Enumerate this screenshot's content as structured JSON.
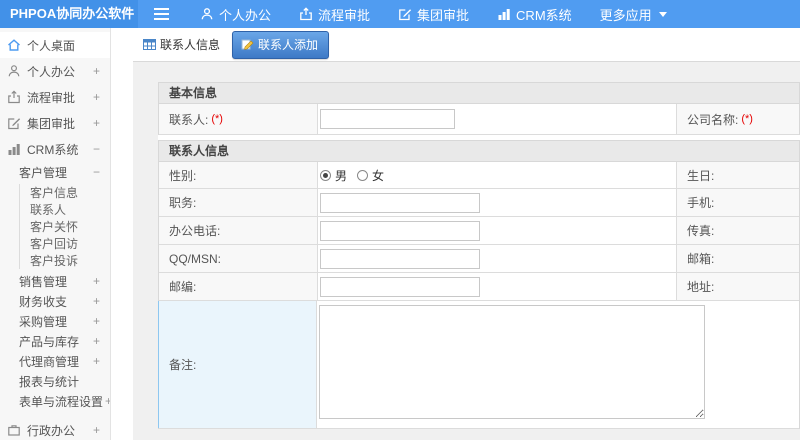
{
  "topbar": {
    "logo": "PHPOA协同办公软件",
    "menu": [
      {
        "label": "个人办公",
        "icon": "user-icon"
      },
      {
        "label": "流程审批",
        "icon": "workflow-icon"
      },
      {
        "label": "集团审批",
        "icon": "edit-icon"
      },
      {
        "label": "CRM系统",
        "icon": "chart-icon"
      },
      {
        "label": "更多应用",
        "icon": "caret-down-icon"
      }
    ]
  },
  "sidebar": {
    "items": [
      {
        "label": "个人桌面",
        "icon": "home-icon",
        "expand": "",
        "active": true
      },
      {
        "label": "个人办公",
        "icon": "user-icon",
        "expand": "+"
      },
      {
        "label": "流程审批",
        "icon": "workflow-icon",
        "expand": "+"
      },
      {
        "label": "集团审批",
        "icon": "edit-icon",
        "expand": "+"
      },
      {
        "label": "CRM系统",
        "icon": "chart-icon",
        "expand": "−"
      },
      {
        "label": "客户管理",
        "expand": "−"
      },
      {
        "label": "客户信息"
      },
      {
        "label": "联系人"
      },
      {
        "label": "客户关怀"
      },
      {
        "label": "客户回访"
      },
      {
        "label": "客户投诉"
      },
      {
        "label": "销售管理",
        "expand": "+"
      },
      {
        "label": "财务收支",
        "expand": "+"
      },
      {
        "label": "采购管理",
        "expand": "+"
      },
      {
        "label": "产品与库存",
        "expand": "+"
      },
      {
        "label": "代理商管理",
        "expand": "+"
      },
      {
        "label": "报表与统计",
        "expand": ""
      },
      {
        "label": "表单与流程设置",
        "expand": "+"
      },
      {
        "label": "行政办公",
        "icon": "briefcase-icon",
        "expand": "+"
      }
    ]
  },
  "tabs": [
    {
      "label": "联系人信息",
      "icon": "table-icon",
      "active": false
    },
    {
      "label": "联系人添加",
      "icon": "add-contact-icon",
      "active": true
    }
  ],
  "form": {
    "sections": [
      {
        "title": "基本信息",
        "rows": [
          {
            "label": "联系人:",
            "required": "(*)",
            "value": "",
            "label2": "公司名称:",
            "required2": "(*)"
          }
        ]
      },
      {
        "title": "联系人信息",
        "rows": [
          {
            "label": "性别:",
            "options": [
              "男",
              "女"
            ],
            "selected": "男",
            "label2": "生日:"
          },
          {
            "label": "职务:",
            "value": "",
            "label2": "手机:"
          },
          {
            "label": "办公电话:",
            "value": "",
            "label2": "传真:"
          },
          {
            "label": "QQ/MSN:",
            "value": "",
            "label2": "邮箱:"
          },
          {
            "label": "邮编:",
            "value": "",
            "label2": "地址:"
          },
          {
            "label": "备注:",
            "value": ""
          }
        ]
      }
    ]
  },
  "colors": {
    "topbar": "#509cf1",
    "logo_bg": "#4291e8",
    "accent": "#4d9bf1",
    "required": "#e60000",
    "active_tab_top": "#6ba7e8",
    "active_tab_bottom": "#3d79c6",
    "remark_highlight": "#eaf5fc"
  }
}
